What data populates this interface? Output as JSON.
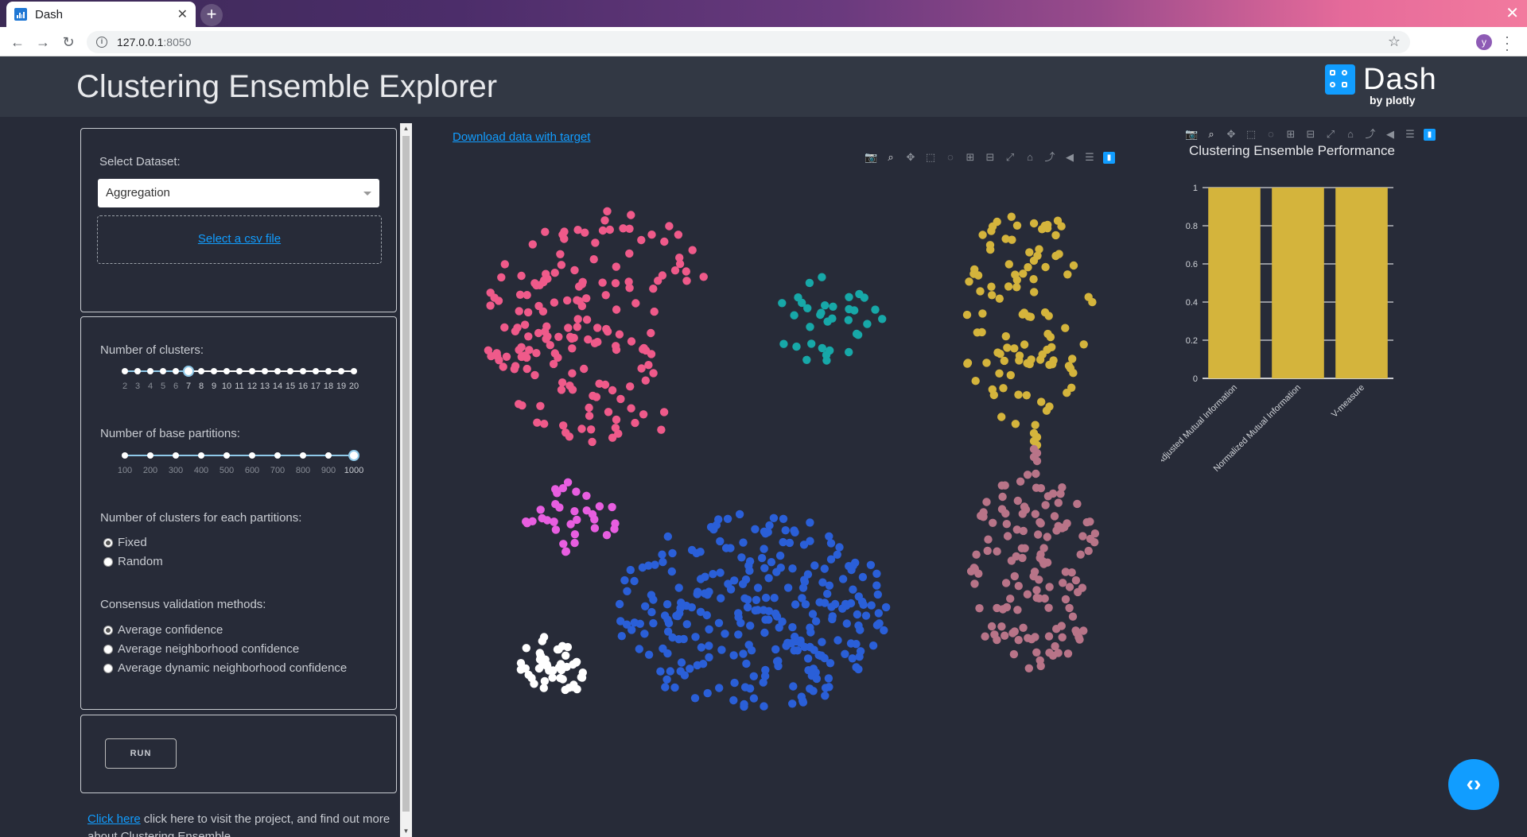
{
  "browser": {
    "tab_title": "Dash",
    "url_host": "127.0.0.1",
    "url_port": ":8050",
    "avatar_letter": "y"
  },
  "header": {
    "title": "Clustering Ensemble Explorer",
    "logo_word": "Dash",
    "logo_sub": "by plotly"
  },
  "dataset_panel": {
    "label": "Select Dataset:",
    "selected": "Aggregation",
    "upload_link": "Select a csv file"
  },
  "params_panel": {
    "clusters_label": "Number of clusters:",
    "clusters_ticks": [
      "2",
      "3",
      "4",
      "5",
      "6",
      "7",
      "8",
      "9",
      "10",
      "11",
      "12",
      "13",
      "14",
      "15",
      "16",
      "17",
      "18",
      "19",
      "20"
    ],
    "clusters_value": 7,
    "partitions_label": "Number of base partitions:",
    "partitions_ticks": [
      "100",
      "200",
      "300",
      "400",
      "500",
      "600",
      "700",
      "800",
      "900",
      "1000"
    ],
    "partitions_value": 1000,
    "each_label": "Number of clusters for each partitions:",
    "each_options": [
      "Fixed",
      "Random"
    ],
    "each_selected": "Fixed",
    "consensus_label": "Consensus validation methods:",
    "consensus_options": [
      "Average confidence",
      "Average neighborhood confidence",
      "Average dynamic neighborhood confidence"
    ],
    "consensus_selected": "Average confidence"
  },
  "run_button": "RUN",
  "footer": {
    "link": "Click here",
    "text": " click here to visit the project, and find out more about Clustering Ensemble"
  },
  "main": {
    "download_link": "Download data with target"
  },
  "colors": {
    "pink": "#ef5a8a",
    "teal": "#17a8a8",
    "gold": "#d4b43c",
    "magenta": "#e85ee0",
    "blue": "#2a5fd8",
    "white": "#ffffff",
    "mauve": "#b87488",
    "bar": "#d4b43c",
    "accent": "#119dff"
  },
  "chart_data": {
    "type": "bar",
    "title": "Clustering Ensemble Performance",
    "categories": [
      "Adjusted Mutual Information",
      "Normalized Mutual Information",
      "V-measure"
    ],
    "values": [
      1,
      1,
      1
    ],
    "ylim": [
      0,
      1
    ],
    "yticks": [
      "0",
      "0.2",
      "0.4",
      "0.6",
      "0.8",
      "1"
    ]
  },
  "scatter_clusters": [
    {
      "name": "pink",
      "color": "#ef5a8a",
      "n": 170
    },
    {
      "name": "teal",
      "color": "#17a8a8",
      "n": 34
    },
    {
      "name": "gold",
      "color": "#d4b43c",
      "n": 102
    },
    {
      "name": "magenta",
      "color": "#e85ee0",
      "n": 34
    },
    {
      "name": "blue",
      "color": "#2a5fd8",
      "n": 273
    },
    {
      "name": "white",
      "color": "#ffffff",
      "n": 45
    },
    {
      "name": "mauve",
      "color": "#b87488",
      "n": 130
    }
  ]
}
